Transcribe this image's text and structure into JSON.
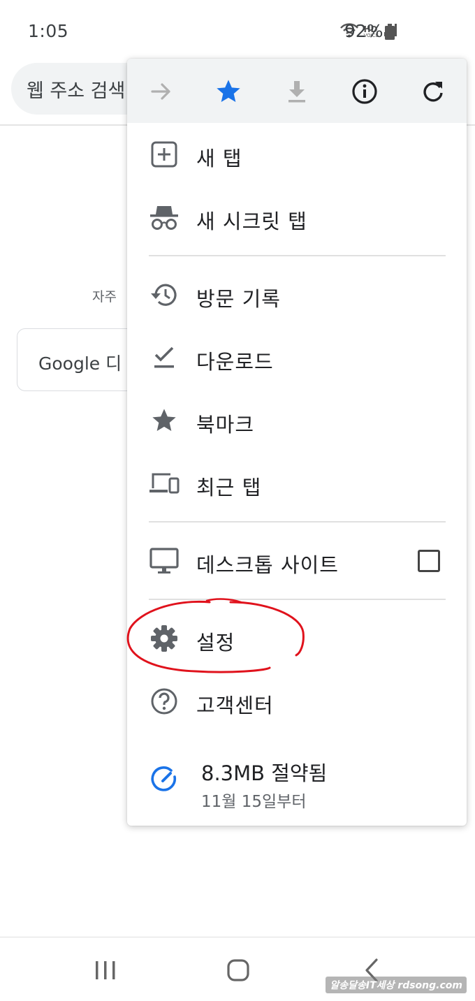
{
  "status_bar": {
    "time": "1:05",
    "battery": "92%",
    "network_label_top": "HD",
    "network_label_bottom": "VOICE"
  },
  "background": {
    "omnibox_placeholder": "웹 주소 검색",
    "frequent_label": "자주",
    "google_card_text": "Google 디"
  },
  "menu": {
    "toolbar_icons": [
      "forward-icon",
      "bookmark-star-icon",
      "download-icon",
      "info-icon",
      "refresh-icon"
    ],
    "bookmark_star_color": "#1a73e8",
    "items": [
      {
        "label": "새 탭",
        "icon": "new-tab-icon"
      },
      {
        "label": "새 시크릿 탭",
        "icon": "incognito-icon"
      },
      {
        "label": "방문 기록",
        "icon": "history-icon"
      },
      {
        "label": "다운로드",
        "icon": "downloads-check-icon"
      },
      {
        "label": "북마크",
        "icon": "star-icon"
      },
      {
        "label": "최근 탭",
        "icon": "devices-icon"
      },
      {
        "label": "데스크톱 사이트",
        "icon": "monitor-icon",
        "checked": false
      },
      {
        "label": "설정",
        "icon": "gear-icon"
      },
      {
        "label": "고객센터",
        "icon": "help-icon"
      }
    ],
    "data_savings": {
      "title": "8.3MB 절약됨",
      "subtitle": "11월 15일부터",
      "icon": "data-saver-gauge-icon",
      "icon_color": "#1a73e8"
    }
  },
  "annotation": {
    "type": "hand-drawn circle",
    "target": "설정",
    "color": "#e0121c"
  },
  "watermark": "알송달송IT세상 rdsong.com"
}
